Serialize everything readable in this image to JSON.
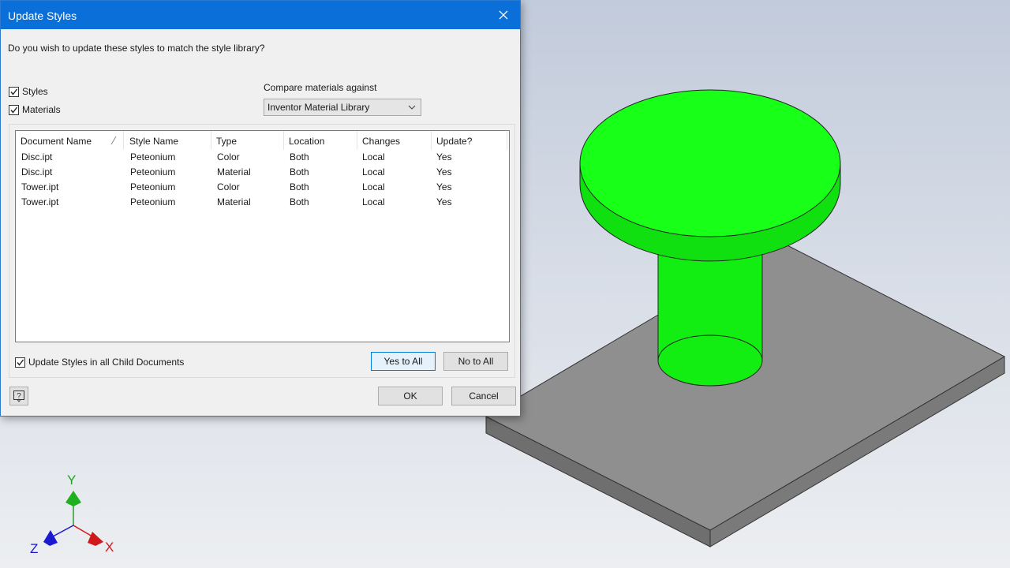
{
  "dialog": {
    "title": "Update Styles",
    "question": "Do you wish to update these styles to match the style library?",
    "checkboxes": {
      "styles": {
        "label": "Styles",
        "checked": true
      },
      "materials": {
        "label": "Materials",
        "checked": true
      }
    },
    "compare": {
      "label": "Compare materials against",
      "value": "Inventor Material Library"
    },
    "table": {
      "columns": [
        "Document Name",
        "Style Name",
        "Type",
        "Location",
        "Changes",
        "Update?"
      ],
      "rows": [
        [
          "Disc.ipt",
          "Peteonium",
          "Color",
          "Both",
          "Local",
          "Yes"
        ],
        [
          "Disc.ipt",
          "Peteonium",
          "Material",
          "Both",
          "Local",
          "Yes"
        ],
        [
          "Tower.ipt",
          "Peteonium",
          "Color",
          "Both",
          "Local",
          "Yes"
        ],
        [
          "Tower.ipt",
          "Peteonium",
          "Material",
          "Both",
          "Local",
          "Yes"
        ]
      ]
    },
    "child_docs": {
      "label": "Update Styles in all Child Documents",
      "checked": true
    },
    "buttons": {
      "yes_to_all": "Yes to All",
      "no_to_all": "No to All",
      "ok": "OK",
      "cancel": "Cancel"
    }
  },
  "viewport": {
    "axis_labels": {
      "x": "X",
      "y": "Y",
      "z": "Z"
    },
    "colors": {
      "part_green": "#12f412",
      "plate_gray": "#8c8c8c",
      "x_axis": "#d0191b",
      "y_axis": "#1aa51a",
      "z_axis": "#1a1ad0",
      "title_bar": "#0a6fd8"
    }
  }
}
